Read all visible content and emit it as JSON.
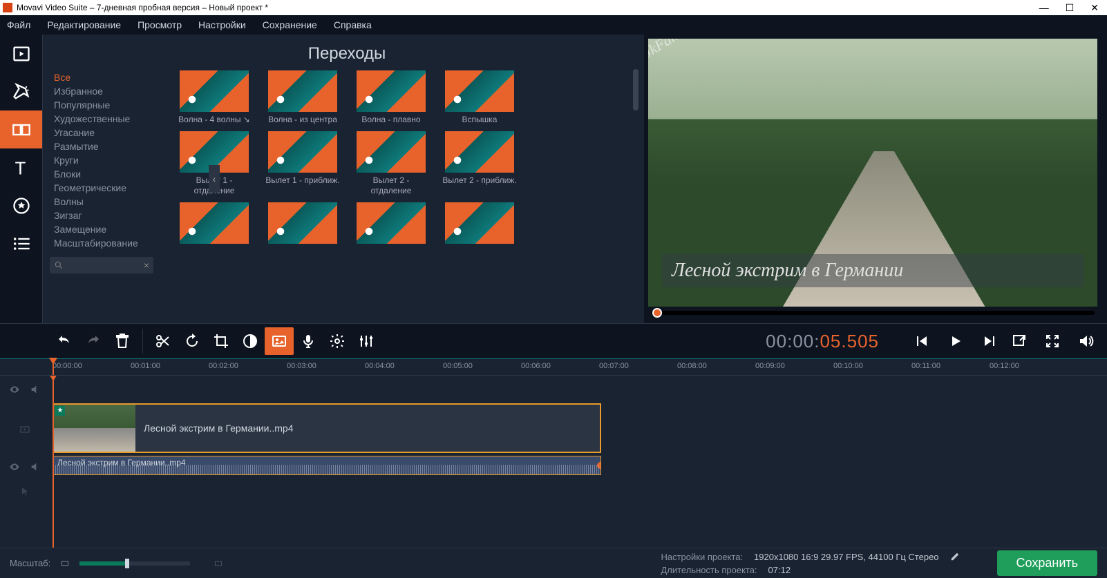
{
  "window": {
    "title": "Movavi Video Suite – 7-дневная пробная версия – Новый проект *"
  },
  "menu": [
    "Файл",
    "Редактирование",
    "Просмотр",
    "Настройки",
    "Сохранение",
    "Справка"
  ],
  "panel": {
    "title": "Переходы",
    "categories": [
      "Все",
      "Избранное",
      "Популярные",
      "Художественные",
      "Угасание",
      "Размытие",
      "Круги",
      "Блоки",
      "Геометрические",
      "Волны",
      "Зигзаг",
      "Замещение",
      "Масштабирование"
    ],
    "active_category": "Все",
    "thumbs": [
      {
        "label": "Волна - 4 волны ↘"
      },
      {
        "label": "Волна - из центра"
      },
      {
        "label": "Волна - плавно"
      },
      {
        "label": "Вспышка"
      },
      {
        "label": "Вылет 1 - отдаление"
      },
      {
        "label": "Вылет 1 - приближ."
      },
      {
        "label": "Вылет 2 - отдаление"
      },
      {
        "label": "Вылет 2 - приближ."
      },
      {
        "label": ""
      },
      {
        "label": ""
      },
      {
        "label": ""
      },
      {
        "label": ""
      }
    ]
  },
  "preview": {
    "watermark": "JkFam",
    "caption": "Лесной экстрим в Германии"
  },
  "timecode": {
    "gray": "00:00:",
    "orange": "05.505"
  },
  "ruler": [
    "00:00:00",
    "00:01:00",
    "00:02:00",
    "00:03:00",
    "00:04:00",
    "00:05:00",
    "00:06:00",
    "00:07:00",
    "00:08:00",
    "00:09:00",
    "00:10:00",
    "00:11:00",
    "00:12:00"
  ],
  "clips": {
    "video_name": "Лесной экстрим в Германии..mp4",
    "audio_name": "Лесной экстрим в Германии..mp4"
  },
  "status": {
    "zoom_label": "Масштаб:",
    "settings_label": "Настройки проекта:",
    "settings_value": "1920x1080 16:9 29.97 FPS, 44100 Гц Стерео",
    "duration_label": "Длительность проекта:",
    "duration_value": "07:12",
    "save": "Сохранить"
  }
}
